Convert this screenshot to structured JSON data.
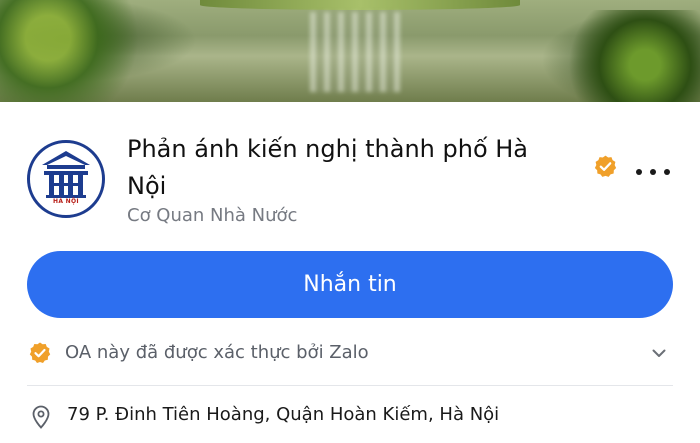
{
  "profile": {
    "name": "Phản ánh kiến nghị thành phố Hà Nội",
    "category": "Cơ Quan Nhà Nước",
    "logo_text": "HÀ NỘI"
  },
  "actions": {
    "message_label": "Nhắn tin",
    "more_icon": "more-horizontal-icon"
  },
  "verification": {
    "text": "OA này đã được xác thực bởi Zalo",
    "badge_icon": "verified-badge-icon",
    "badge_color": "#f0a02a"
  },
  "info": {
    "address": "79 P. Đinh Tiên Hoàng, Quận Hoàn Kiếm, Hà Nội",
    "address_icon": "location-pin-icon"
  },
  "colors": {
    "primary": "#2d6ff0",
    "logo_blue": "#1d3c8f",
    "logo_red": "#b8201a"
  }
}
